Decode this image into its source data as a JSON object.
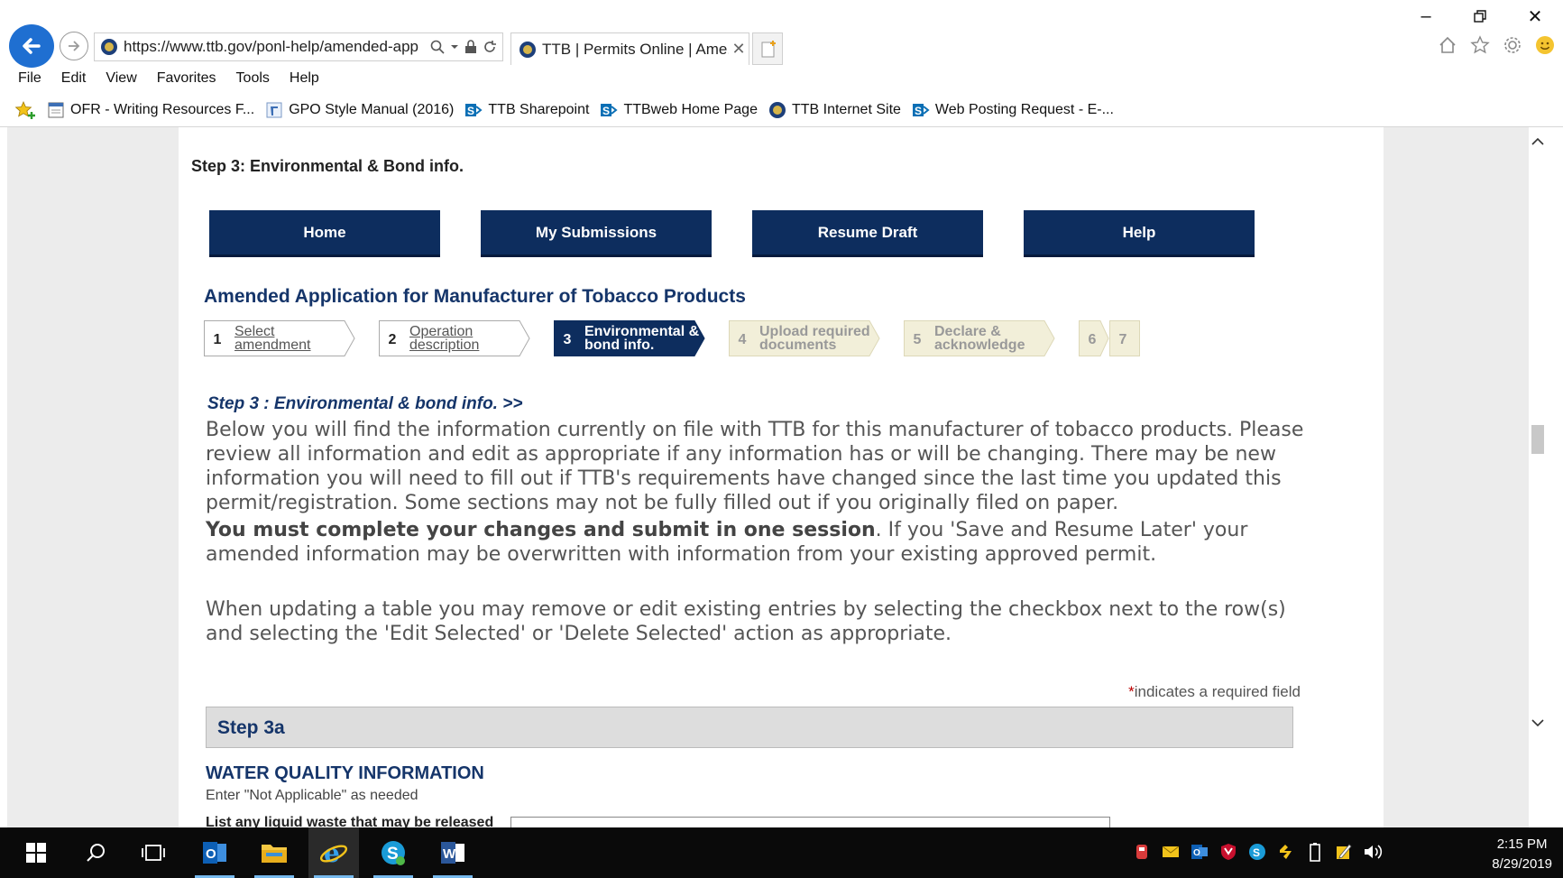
{
  "browser": {
    "url": "https://www.ttb.gov/ponl-help/amended-app",
    "tab_title": "TTB | Permits Online | Ame...",
    "menu": [
      "File",
      "Edit",
      "View",
      "Favorites",
      "Tools",
      "Help"
    ],
    "favorites": [
      {
        "label": "OFR - Writing Resources F...",
        "icon": "page-icon"
      },
      {
        "label": "GPO Style Manual (2016)",
        "icon": "link-icon"
      },
      {
        "label": "TTB Sharepoint",
        "icon": "sharepoint-icon"
      },
      {
        "label": "TTBweb Home Page",
        "icon": "sharepoint-icon"
      },
      {
        "label": "TTB Internet Site",
        "icon": "ttb-seal-icon"
      },
      {
        "label": "Web Posting Request - E-...",
        "icon": "sharepoint-icon"
      }
    ]
  },
  "page": {
    "step_heading": "Step 3: Environmental & Bond info.",
    "nav": [
      "Home",
      "My Submissions",
      "Resume Draft",
      "Help"
    ],
    "app_title": "Amended Application for Manufacturer of Tobacco Products",
    "steps": [
      {
        "num": "1",
        "line1": "Select",
        "line2": "amendment",
        "state": "link"
      },
      {
        "num": "2",
        "line1": "Operation",
        "line2": "description",
        "state": "link"
      },
      {
        "num": "3",
        "line1": "Environmental &",
        "line2": "bond info.",
        "state": "active"
      },
      {
        "num": "4",
        "line1": "Upload required",
        "line2": "documents",
        "state": "disabled"
      },
      {
        "num": "5",
        "line1": "Declare &",
        "line2": "acknowledge",
        "state": "disabled"
      },
      {
        "num": "6",
        "line1": "",
        "line2": "",
        "state": "disabled"
      },
      {
        "num": "7",
        "line1": "",
        "line2": "",
        "state": "disabled"
      }
    ],
    "sub_heading": "Step 3 : Environmental & bond info. >>",
    "para1": "Below you will find the information currently on file with TTB for this manufacturer of tobacco products. Please review all information and edit as appropriate if any information has or will be changing. There may be new information you will need to fill out if TTB's requirements have changed since the last time you updated this permit/registration. Some sections may not be fully filled out if you originally filed on paper.",
    "para2_bold": "You must complete your changes and submit in one session",
    "para2_rest": ". If you 'Save and Resume Later' your amended information may be overwritten with information from your existing approved permit.",
    "para3": "When updating a table you may remove or edit existing entries by selecting the checkbox next to the row(s) and selecting the 'Edit Selected' or 'Delete Selected' action as appropriate.",
    "required_star": "*",
    "required_note": "indicates a required field",
    "section_label": "Step 3a",
    "water_title": "WATER QUALITY INFORMATION",
    "water_hint": "Enter \"Not Applicable\" as needed",
    "water_field_label": "List any liquid waste that may be released"
  },
  "taskbar": {
    "time": "2:15 PM",
    "date": "8/29/2019"
  },
  "colors": {
    "nav_bg": "#0d2d5e",
    "title": "#15356a",
    "step_active": "#0d2d5e",
    "step_disabled": "#f2efd9"
  }
}
